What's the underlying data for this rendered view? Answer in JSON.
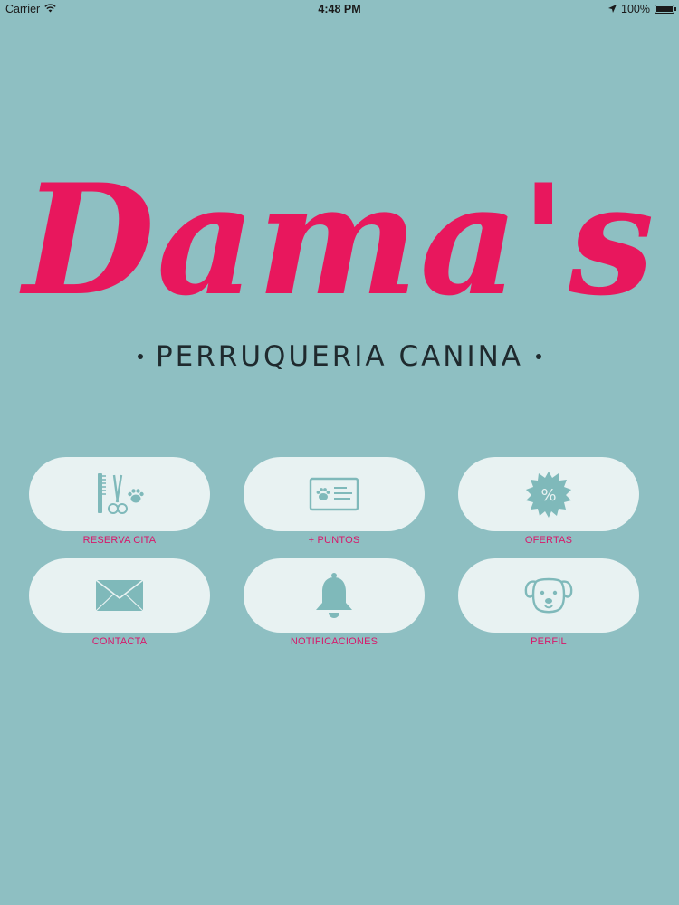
{
  "status_bar": {
    "carrier": "Carrier",
    "time": "4:48 PM",
    "battery": "100%",
    "battery_level": 1.0
  },
  "logo": {
    "script_text": "Dama's",
    "subtitle": "PERRUQUERIA CANINA"
  },
  "colors": {
    "background": "#8ebfc2",
    "brand_pink": "#e8175d",
    "pill_bg": "#e8f2f2",
    "icon_teal": "#7fb9ba"
  },
  "menu": {
    "items": [
      {
        "label": "RESERVA CITA",
        "icon": "grooming-tools-icon"
      },
      {
        "label": "+ PUNTOS",
        "icon": "loyalty-card-icon"
      },
      {
        "label": "OFERTAS",
        "icon": "discount-badge-icon"
      },
      {
        "label": "CONTACTA",
        "icon": "envelope-icon"
      },
      {
        "label": "NOTIFICACIONES",
        "icon": "bell-icon"
      },
      {
        "label": "PERFIL",
        "icon": "dog-face-icon"
      }
    ]
  }
}
